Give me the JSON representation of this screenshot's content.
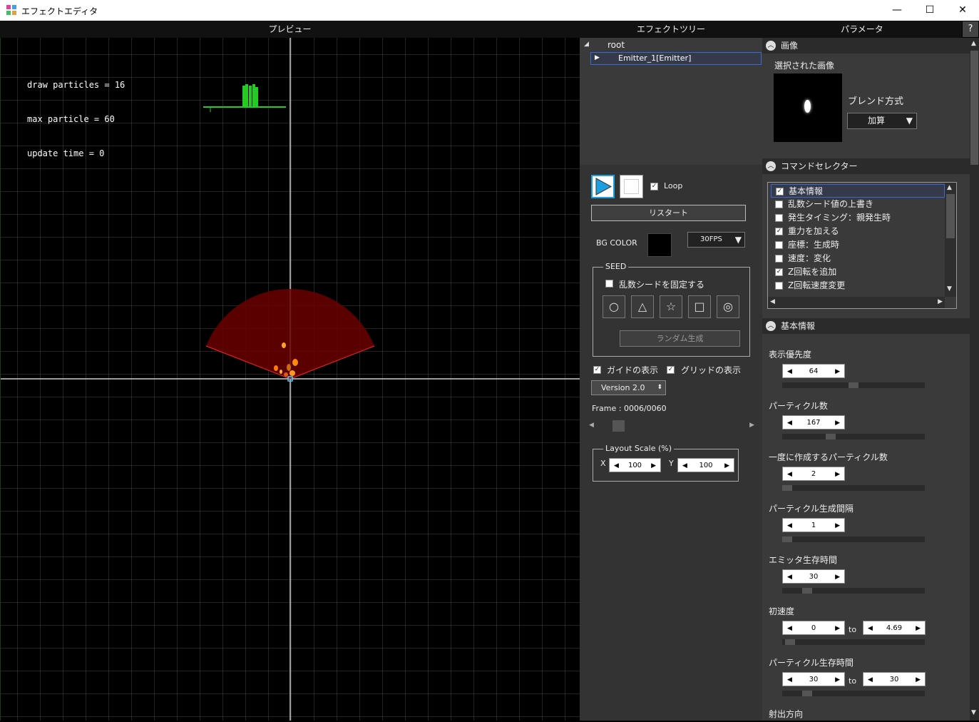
{
  "window": {
    "title": "エフェクトエディタ",
    "minimize": "—",
    "maximize": "☐",
    "close": "✕"
  },
  "headers": {
    "preview": "プレビュー",
    "tree": "エフェクトツリー",
    "params": "パラメータ",
    "help": "?"
  },
  "preview": {
    "stats": [
      "draw particles = 16",
      "max particle = 60",
      "update time = 0"
    ]
  },
  "tree": {
    "root": "root",
    "emitter": "Emitter_1[Emitter]"
  },
  "controls": {
    "loop": "Loop",
    "restart": "リスタート",
    "bg_color_label": "BG COLOR",
    "bg_color": "#000000",
    "fps": "30FPS",
    "seed_title": "SEED",
    "fix_seed": "乱数シードを固定する",
    "shapes": [
      "○",
      "△",
      "☆",
      "□",
      "◎"
    ],
    "random_gen": "ランダム生成",
    "show_guide": "ガイドの表示",
    "show_grid": "グリッドの表示",
    "version": "Version 2.0",
    "frame": "Frame : 0006/0060",
    "frame_current": 6,
    "frame_total": 60,
    "layout_title": "Layout Scale (%)",
    "x_label": "X",
    "y_label": "Y",
    "x_value": "100",
    "y_value": "100"
  },
  "params": {
    "image_section": "画像",
    "selected_image": "選択された画像",
    "blend_label": "ブレンド方式",
    "blend_value": "加算",
    "command_section": "コマンドセレクター",
    "commands": [
      {
        "label": "基本情報",
        "checked": true
      },
      {
        "label": "乱数シード値の上書き",
        "checked": false
      },
      {
        "label": "発生タイミング：親発生時",
        "checked": false
      },
      {
        "label": "重力を加える",
        "checked": true
      },
      {
        "label": "座標：生成時",
        "checked": false
      },
      {
        "label": "速度：変化",
        "checked": false
      },
      {
        "label": "Z回転を追加",
        "checked": true
      },
      {
        "label": "Z回転速度変更",
        "checked": false
      }
    ],
    "basic_section": "基本情報",
    "fields": [
      {
        "label": "表示優先度",
        "value": "64",
        "slider": 0.5
      },
      {
        "label": "パーティクル数",
        "value": "167",
        "slider": 0.33
      },
      {
        "label": "一度に作成するパーティクル数",
        "value": "2",
        "slider": 0.0
      },
      {
        "label": "パーティクル生成間隔",
        "value": "1",
        "slider": 0.0
      },
      {
        "label": "エミッタ生存時間",
        "value": "30",
        "slider": 0.15
      },
      {
        "label": "初速度",
        "value": "0",
        "value2": "4.69",
        "to": "to",
        "slider": 0.02
      },
      {
        "label": "パーティクル生存時間",
        "value": "30",
        "value2": "30",
        "to": "to",
        "slider": 0.15
      }
    ],
    "emit_direction": "射出方向"
  },
  "colors": {
    "accent": "#1ba1e2",
    "graph": "#22cc22",
    "fan": "#8b0000",
    "fan_edge": "#ff2222"
  }
}
